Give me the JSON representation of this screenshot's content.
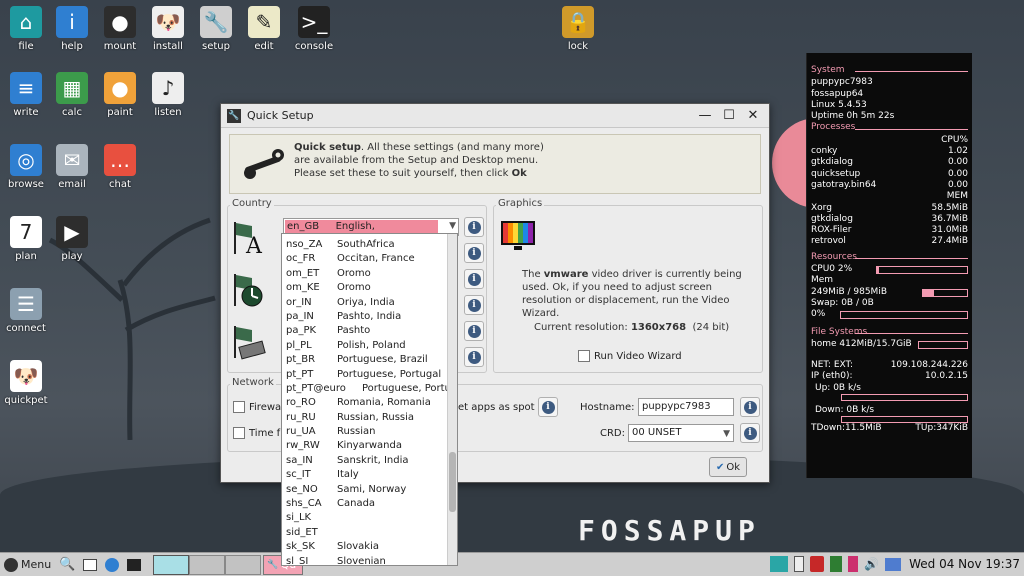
{
  "desktop": {
    "icons": [
      {
        "label": "file",
        "icon": "home-icon"
      },
      {
        "label": "help",
        "icon": "info-icon"
      },
      {
        "label": "mount",
        "icon": "drive-icon"
      },
      {
        "label": "install",
        "icon": "puppy-install-icon"
      },
      {
        "label": "setup",
        "icon": "wrench-icon"
      },
      {
        "label": "edit",
        "icon": "pencil-notepad-icon"
      },
      {
        "label": "console",
        "icon": "terminal-icon"
      },
      {
        "label": "lock",
        "icon": "padlock-icon"
      },
      {
        "label": "write",
        "icon": "document-icon"
      },
      {
        "label": "calc",
        "icon": "spreadsheet-icon"
      },
      {
        "label": "paint",
        "icon": "palette-icon"
      },
      {
        "label": "listen",
        "icon": "music-note-icon"
      },
      {
        "label": "browse",
        "icon": "globe-icon"
      },
      {
        "label": "email",
        "icon": "envelope-icon"
      },
      {
        "label": "chat",
        "icon": "chat-bubble-icon"
      },
      {
        "label": "plan",
        "icon": "calendar-icon"
      },
      {
        "label": "play",
        "icon": "video-play-icon"
      },
      {
        "label": "connect",
        "icon": "network-icon"
      },
      {
        "label": "quickpet",
        "icon": "puppy-face-icon"
      }
    ],
    "wallpaper_brand": "FOSSAPUP"
  },
  "window": {
    "title": "Quick Setup",
    "intro_bold": "Quick setup",
    "intro_line1_rest": ". All these settings (and many more)",
    "intro_line2": "are available from the Setup and Desktop menu.",
    "intro_line3_pre": "Please set these to suit yourself, then click ",
    "intro_line3_bold": "Ok",
    "country_label": "Country",
    "locale_selected_code": "en_GB",
    "locale_selected_name": "English, GreatBritain",
    "graphics_label": "Graphics",
    "graphics_text_pre": "The ",
    "graphics_driver": "vmware",
    "graphics_text_post": " video driver is currently being used. Ok, if you need to adjust screen resolution or displacement, run the Video Wizard.",
    "resolution_label": "Current resolution: ",
    "resolution_value": "1360x768",
    "resolution_depth": "(24 bit)",
    "video_wizard_label": "Run Video Wizard",
    "network_label": "Network",
    "firewall_label": "Firewa",
    "time_label": "Time fr",
    "apps_spot_label": "et apps as spot",
    "hostname_label": "Hostname:",
    "hostname_value": "puppypc7983",
    "crd_label": "CRD:",
    "crd_value": "00 UNSET",
    "ok_label": "Ok"
  },
  "locale_list": [
    {
      "code": "nso_ZA",
      "name": "SouthAfrica"
    },
    {
      "code": "oc_FR",
      "name": "Occitan, France"
    },
    {
      "code": "om_ET",
      "name": "Oromo"
    },
    {
      "code": "om_KE",
      "name": "Oromo"
    },
    {
      "code": "or_IN",
      "name": "Oriya, India"
    },
    {
      "code": "pa_IN",
      "name": "Pashto, India"
    },
    {
      "code": "pa_PK",
      "name": "Pashto"
    },
    {
      "code": "pl_PL",
      "name": "Polish, Poland"
    },
    {
      "code": "pt_BR",
      "name": "Portuguese, Brazil"
    },
    {
      "code": "pt_PT",
      "name": "Portuguese, Portugal"
    },
    {
      "code": "pt_PT@euro",
      "name": "Portuguese, Portu"
    },
    {
      "code": "ro_RO",
      "name": "Romania, Romania"
    },
    {
      "code": "ru_RU",
      "name": "Russian, Russia"
    },
    {
      "code": "ru_UA",
      "name": "Russian"
    },
    {
      "code": "rw_RW",
      "name": "Kinyarwanda"
    },
    {
      "code": "sa_IN",
      "name": "Sanskrit, India"
    },
    {
      "code": "sc_IT",
      "name": "Italy"
    },
    {
      "code": "se_NO",
      "name": "Sami, Norway"
    },
    {
      "code": "shs_CA",
      "name": "Canada"
    },
    {
      "code": "si_LK",
      "name": ""
    },
    {
      "code": "sid_ET",
      "name": ""
    },
    {
      "code": "sk_SK",
      "name": "Slovakia"
    },
    {
      "code": "sl_SI",
      "name": "Slovenian"
    }
  ],
  "conky": {
    "system_label": "System",
    "hostname": "puppypc7983",
    "distro": "fossapup64",
    "kernel": "Linux 5.4.53",
    "uptime": "Uptime 0h 5m 22s",
    "processes_label": "Processes",
    "cpu_header": "CPU%",
    "cpu_procs": [
      {
        "name": "conky",
        "value": "1.02"
      },
      {
        "name": "gtkdialog",
        "value": "0.00"
      },
      {
        "name": "quicksetup",
        "value": "0.00"
      },
      {
        "name": "gatotray.bin64",
        "value": "0.00"
      }
    ],
    "mem_header": "MEM",
    "mem_procs": [
      {
        "name": "Xorg",
        "value": "58.5MiB"
      },
      {
        "name": "gtkdialog",
        "value": "36.7MiB"
      },
      {
        "name": "ROX-Filer",
        "value": "31.0MiB"
      },
      {
        "name": "retrovol",
        "value": "27.4MiB"
      }
    ],
    "resources_label": "Resources",
    "cpu0": "CPU0 2%",
    "cpu0_fraction": 0.02,
    "mem_label": "Mem",
    "mem_value": "249MiB / 985MiB",
    "mem_fraction": 0.25,
    "swap_value": "Swap: 0B  / 0B",
    "swap_percent": "0%",
    "fs_label": "File Systems",
    "home_fs": "home 412MiB/15.7GiB",
    "net_ext_label": "NET: EXT:",
    "net_ext_value": "109.108.244.226",
    "net_ip_label": "IP (eth0):",
    "net_ip_value": "10.0.2.15",
    "up_label": "Up: 0B   k/s",
    "down_label": "Down: 0B  k/s",
    "tdown": "TDown:11.5MiB",
    "tup": "TUp:347KiB"
  },
  "taskbar": {
    "menu_label": "Menu",
    "task_label": "Qu",
    "clock": "Wed 04 Nov 19:37"
  }
}
